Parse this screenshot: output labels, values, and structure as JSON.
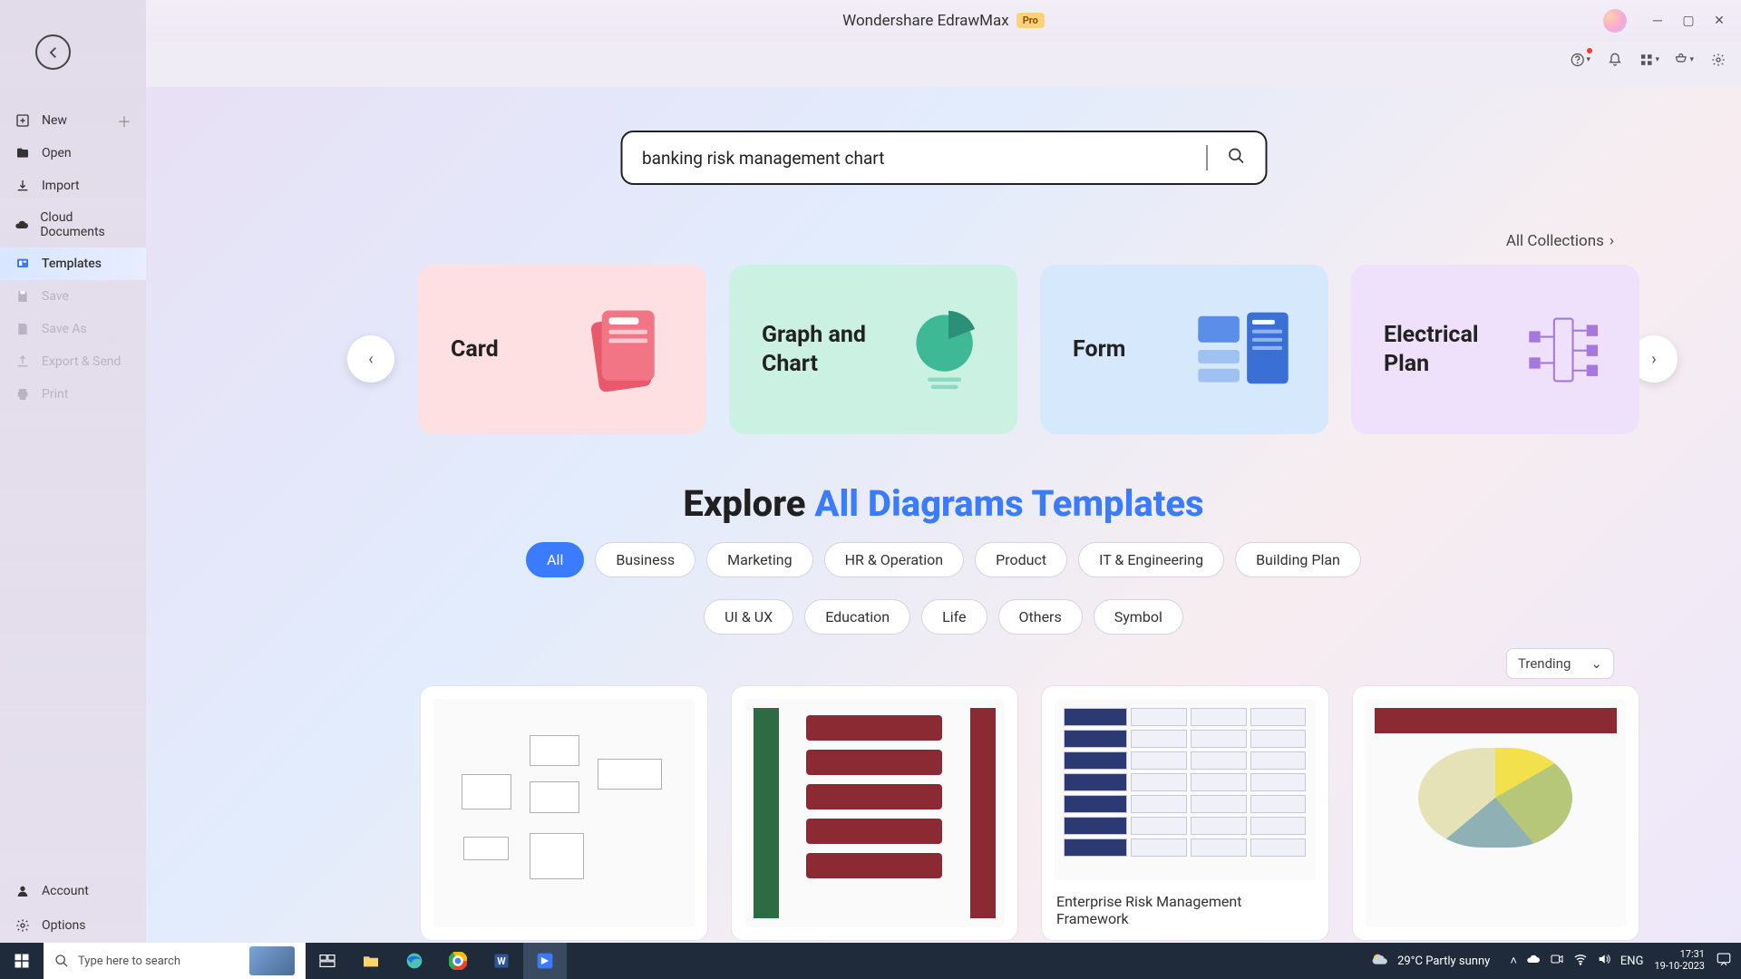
{
  "title": {
    "app": "Wondershare EdrawMax",
    "badge": "Pro"
  },
  "sidebar": {
    "items": [
      {
        "label": "New",
        "icon": "plus-square",
        "hasAdd": true
      },
      {
        "label": "Open",
        "icon": "folder"
      },
      {
        "label": "Import",
        "icon": "import"
      },
      {
        "label": "Cloud Documents",
        "icon": "cloud"
      },
      {
        "label": "Templates",
        "icon": "templates",
        "active": true
      },
      {
        "label": "Save",
        "icon": "save",
        "dim": true
      },
      {
        "label": "Save As",
        "icon": "save-as",
        "dim": true
      },
      {
        "label": "Export & Send",
        "icon": "export",
        "dim": true
      },
      {
        "label": "Print",
        "icon": "print",
        "dim": true
      }
    ],
    "bottom": [
      {
        "label": "Account",
        "icon": "account"
      },
      {
        "label": "Options",
        "icon": "gear"
      }
    ]
  },
  "search": {
    "value": "banking risk management chart"
  },
  "all_collections": "All Collections",
  "categories": [
    {
      "title": "Card",
      "color": "pink"
    },
    {
      "title": "Graph and Chart",
      "color": "green"
    },
    {
      "title": "Form",
      "color": "blue"
    },
    {
      "title": "Electrical Plan",
      "color": "purple"
    }
  ],
  "explore": {
    "pre": "Explore ",
    "hl": "All Diagrams Templates"
  },
  "pills_row1": [
    "All",
    "Business",
    "Marketing",
    "HR & Operation",
    "Product",
    "IT & Engineering",
    "Building Plan"
  ],
  "pills_row2": [
    "UI & UX",
    "Education",
    "Life",
    "Others",
    "Symbol"
  ],
  "sort": {
    "label": "Trending"
  },
  "templates": [
    {
      "title": ""
    },
    {
      "title": ""
    },
    {
      "title": "Enterprise Risk Management Framework"
    },
    {
      "title": ""
    }
  ],
  "taskbar": {
    "search_placeholder": "Type here to search",
    "weather": "29°C  Partly sunny",
    "lang": "ENG",
    "time": "17:31",
    "date": "19-10-2023"
  }
}
